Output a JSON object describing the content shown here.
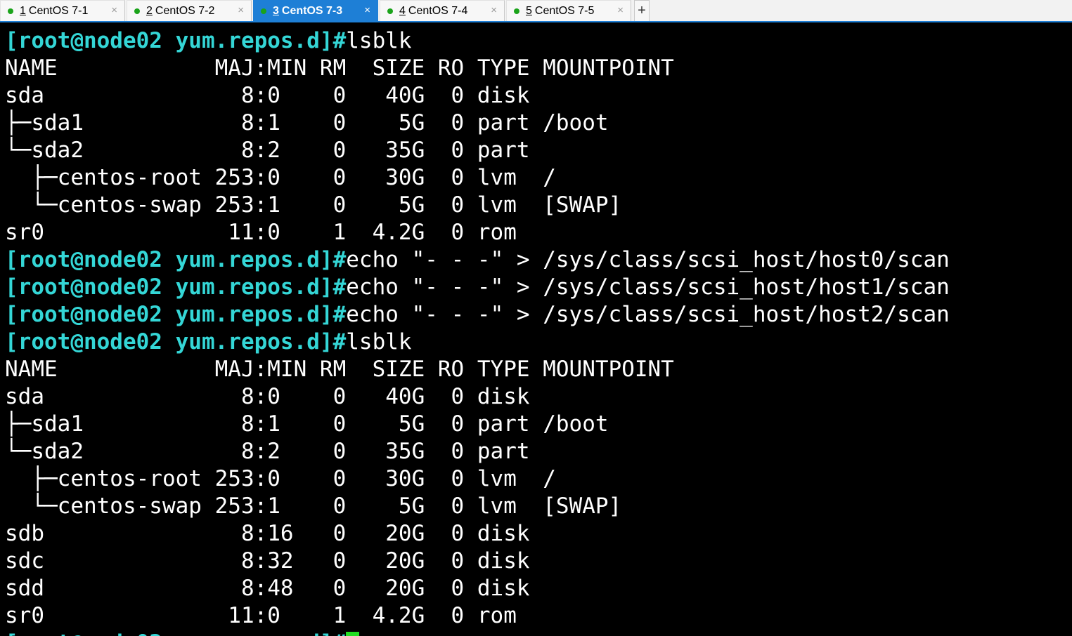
{
  "tabs": [
    {
      "num": "1",
      "label": "CentOS 7-1",
      "active": false
    },
    {
      "num": "2",
      "label": "CentOS 7-2",
      "active": false
    },
    {
      "num": "3",
      "label": "CentOS 7-3",
      "active": true
    },
    {
      "num": "4",
      "label": "CentOS 7-4",
      "active": false
    },
    {
      "num": "5",
      "label": "CentOS 7-5",
      "active": false
    }
  ],
  "tab_close_glyph": "×",
  "new_tab_glyph": "+",
  "terminal": {
    "prompt": "[root@node02 yum.repos.d]#",
    "lines": [
      {
        "prompt": true,
        "text": "lsblk"
      },
      {
        "prompt": false,
        "text": "NAME            MAJ:MIN RM  SIZE RO TYPE MOUNTPOINT"
      },
      {
        "prompt": false,
        "text": "sda               8:0    0   40G  0 disk"
      },
      {
        "prompt": false,
        "text": "├─sda1            8:1    0    5G  0 part /boot"
      },
      {
        "prompt": false,
        "text": "└─sda2            8:2    0   35G  0 part"
      },
      {
        "prompt": false,
        "text": "  ├─centos-root 253:0    0   30G  0 lvm  /"
      },
      {
        "prompt": false,
        "text": "  └─centos-swap 253:1    0    5G  0 lvm  [SWAP]"
      },
      {
        "prompt": false,
        "text": "sr0              11:0    1  4.2G  0 rom"
      },
      {
        "prompt": true,
        "text": "echo \"- - -\" > /sys/class/scsi_host/host0/scan"
      },
      {
        "prompt": true,
        "text": "echo \"- - -\" > /sys/class/scsi_host/host1/scan"
      },
      {
        "prompt": true,
        "text": "echo \"- - -\" > /sys/class/scsi_host/host2/scan"
      },
      {
        "prompt": true,
        "text": "lsblk"
      },
      {
        "prompt": false,
        "text": "NAME            MAJ:MIN RM  SIZE RO TYPE MOUNTPOINT"
      },
      {
        "prompt": false,
        "text": "sda               8:0    0   40G  0 disk"
      },
      {
        "prompt": false,
        "text": "├─sda1            8:1    0    5G  0 part /boot"
      },
      {
        "prompt": false,
        "text": "└─sda2            8:2    0   35G  0 part"
      },
      {
        "prompt": false,
        "text": "  ├─centos-root 253:0    0   30G  0 lvm  /"
      },
      {
        "prompt": false,
        "text": "  └─centos-swap 253:1    0    5G  0 lvm  [SWAP]"
      },
      {
        "prompt": false,
        "text": "sdb               8:16   0   20G  0 disk"
      },
      {
        "prompt": false,
        "text": "sdc               8:32   0   20G  0 disk"
      },
      {
        "prompt": false,
        "text": "sdd               8:48   0   20G  0 disk"
      },
      {
        "prompt": false,
        "text": "sr0              11:0    1  4.2G  0 rom"
      },
      {
        "prompt": true,
        "text": "",
        "cursor": true
      }
    ]
  },
  "colors": {
    "prompt": "#34d6d6",
    "cursor": "#22dd22",
    "active_tab": "#1e7fd6",
    "status_dot": "#1aa31a"
  }
}
